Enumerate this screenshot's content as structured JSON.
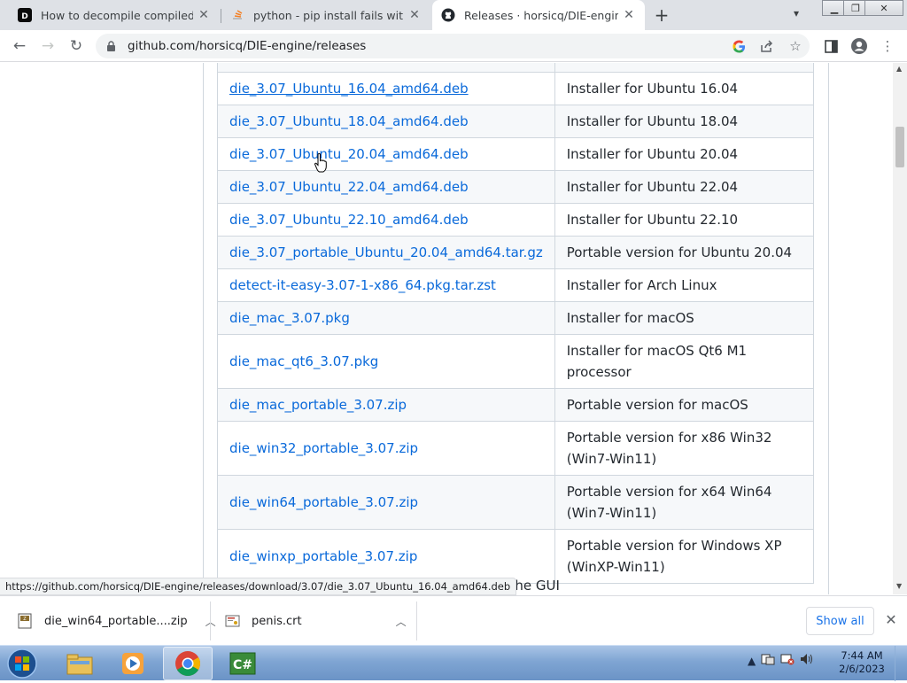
{
  "browser": {
    "tabs": [
      {
        "title": "How to decompile compiled .pyc",
        "favicon": "dev-icon"
      },
      {
        "title": "python - pip install fails with \"co",
        "favicon": "stackoverflow-icon"
      },
      {
        "title": "Releases · horsicq/DIE-engine",
        "favicon": "github-icon",
        "active": true
      }
    ],
    "url": "github.com/horsicq/DIE-engine/releases",
    "status_url": "https://github.com/horsicq/DIE-engine/releases/download/3.07/die_3.07_Ubuntu_16.04_amd64.deb"
  },
  "assets": [
    {
      "file": "die_3.07_Ubuntu_16.04_amd64.deb",
      "desc": "Installer for Ubuntu 16.04"
    },
    {
      "file": "die_3.07_Ubuntu_18.04_amd64.deb",
      "desc": "Installer for Ubuntu 18.04"
    },
    {
      "file": "die_3.07_Ubuntu_20.04_amd64.deb",
      "desc": "Installer for Ubuntu 20.04"
    },
    {
      "file": "die_3.07_Ubuntu_22.04_amd64.deb",
      "desc": "Installer for Ubuntu 22.04"
    },
    {
      "file": "die_3.07_Ubuntu_22.10_amd64.deb",
      "desc": "Installer for Ubuntu 22.10"
    },
    {
      "file": "die_3.07_portable_Ubuntu_20.04_amd64.tar.gz",
      "desc": "Portable version for Ubuntu 20.04"
    },
    {
      "file": "detect-it-easy-3.07-1-x86_64.pkg.tar.zst",
      "desc": "Installer for Arch Linux"
    },
    {
      "file": "die_mac_3.07.pkg",
      "desc": "Installer for macOS"
    },
    {
      "file": "die_mac_qt6_3.07.pkg",
      "desc": "Installer for macOS Qt6 M1 processor"
    },
    {
      "file": "die_mac_portable_3.07.zip",
      "desc": "Portable version for macOS"
    },
    {
      "file": "die_win32_portable_3.07.zip",
      "desc": "Portable version for x86 Win32 (Win7-Win11)"
    },
    {
      "file": "die_win64_portable_3.07.zip",
      "desc": "Portable version for x64 Win64 (Win7-Win11)"
    },
    {
      "file": "die_winxp_portable_3.07.zip",
      "desc": "Portable version for Windows XP (WinXP-Win11)"
    }
  ],
  "below_text": "gs in the GUI",
  "downloads": {
    "items": [
      {
        "name": "die_win64_portable....zip"
      },
      {
        "name": "penis.crt"
      }
    ],
    "show_all": "Show all"
  },
  "taskbar": {
    "time": "7:44 AM",
    "date": "2/6/2023"
  },
  "colors": {
    "link": "#0969da",
    "accent": "#1a73e8"
  }
}
